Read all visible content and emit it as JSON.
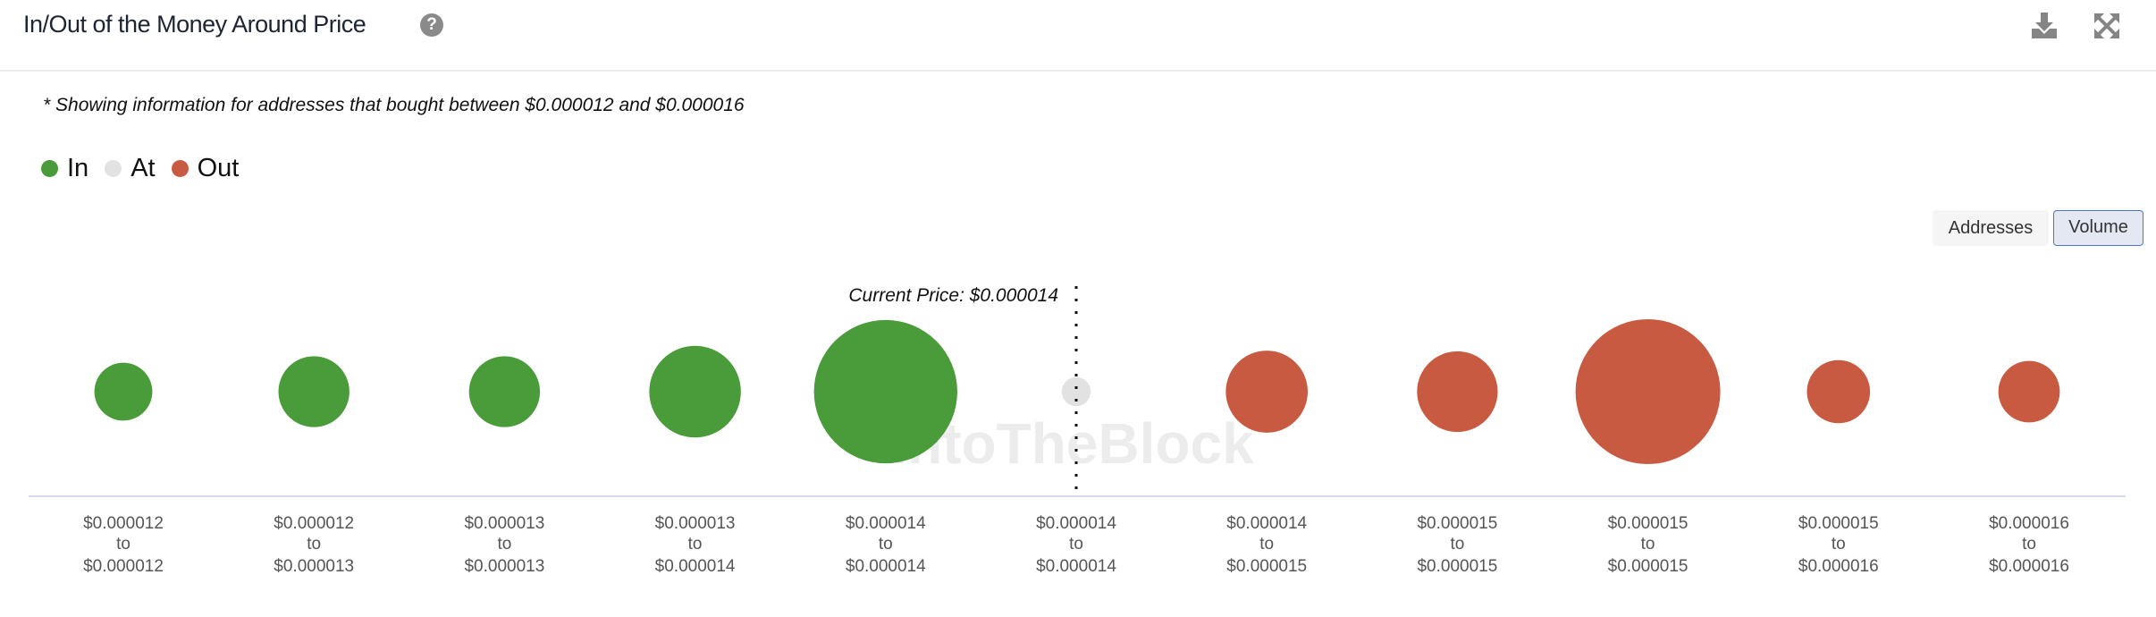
{
  "header": {
    "title": "In/Out of the Money Around Price",
    "help_icon": "question-circle-icon",
    "download_icon": "download-icon",
    "expand_icon": "expand-arrows-icon"
  },
  "note": "* Showing information for addresses that bought between $0.000012 and $0.000016",
  "legend": [
    {
      "label": "In",
      "color": "#4a9c3a"
    },
    {
      "label": "At",
      "color": "#e2e2e2"
    },
    {
      "label": "Out",
      "color": "#c95a42"
    }
  ],
  "toggle": {
    "addresses": "Addresses",
    "volume": "Volume",
    "selected": "Volume"
  },
  "chart_data": {
    "type": "bubble",
    "current_price_label": "Current Price: $0.000014",
    "current_price_index": 5,
    "watermark": "IntoTheBlock",
    "categories": [
      {
        "from": "$0.000012",
        "to": "$0.000012",
        "status": "In",
        "relative_volume": 0.16
      },
      {
        "from": "$0.000012",
        "to": "$0.000013",
        "status": "In",
        "relative_volume": 0.24
      },
      {
        "from": "$0.000013",
        "to": "$0.000013",
        "status": "In",
        "relative_volume": 0.24
      },
      {
        "from": "$0.000013",
        "to": "$0.000014",
        "status": "In",
        "relative_volume": 0.4
      },
      {
        "from": "$0.000014",
        "to": "$0.000014",
        "status": "In",
        "relative_volume": 0.98
      },
      {
        "from": "$0.000014",
        "to": "$0.000014",
        "status": "At",
        "relative_volume": 0.04
      },
      {
        "from": "$0.000014",
        "to": "$0.000015",
        "status": "Out",
        "relative_volume": 0.32
      },
      {
        "from": "$0.000015",
        "to": "$0.000015",
        "status": "Out",
        "relative_volume": 0.31
      },
      {
        "from": "$0.000015",
        "to": "$0.000015",
        "status": "Out",
        "relative_volume": 1.0
      },
      {
        "from": "$0.000015",
        "to": "$0.000016",
        "status": "Out",
        "relative_volume": 0.19
      },
      {
        "from": "$0.000016",
        "to": "$0.000016",
        "status": "Out",
        "relative_volume": 0.18
      }
    ],
    "range_word": "to"
  }
}
